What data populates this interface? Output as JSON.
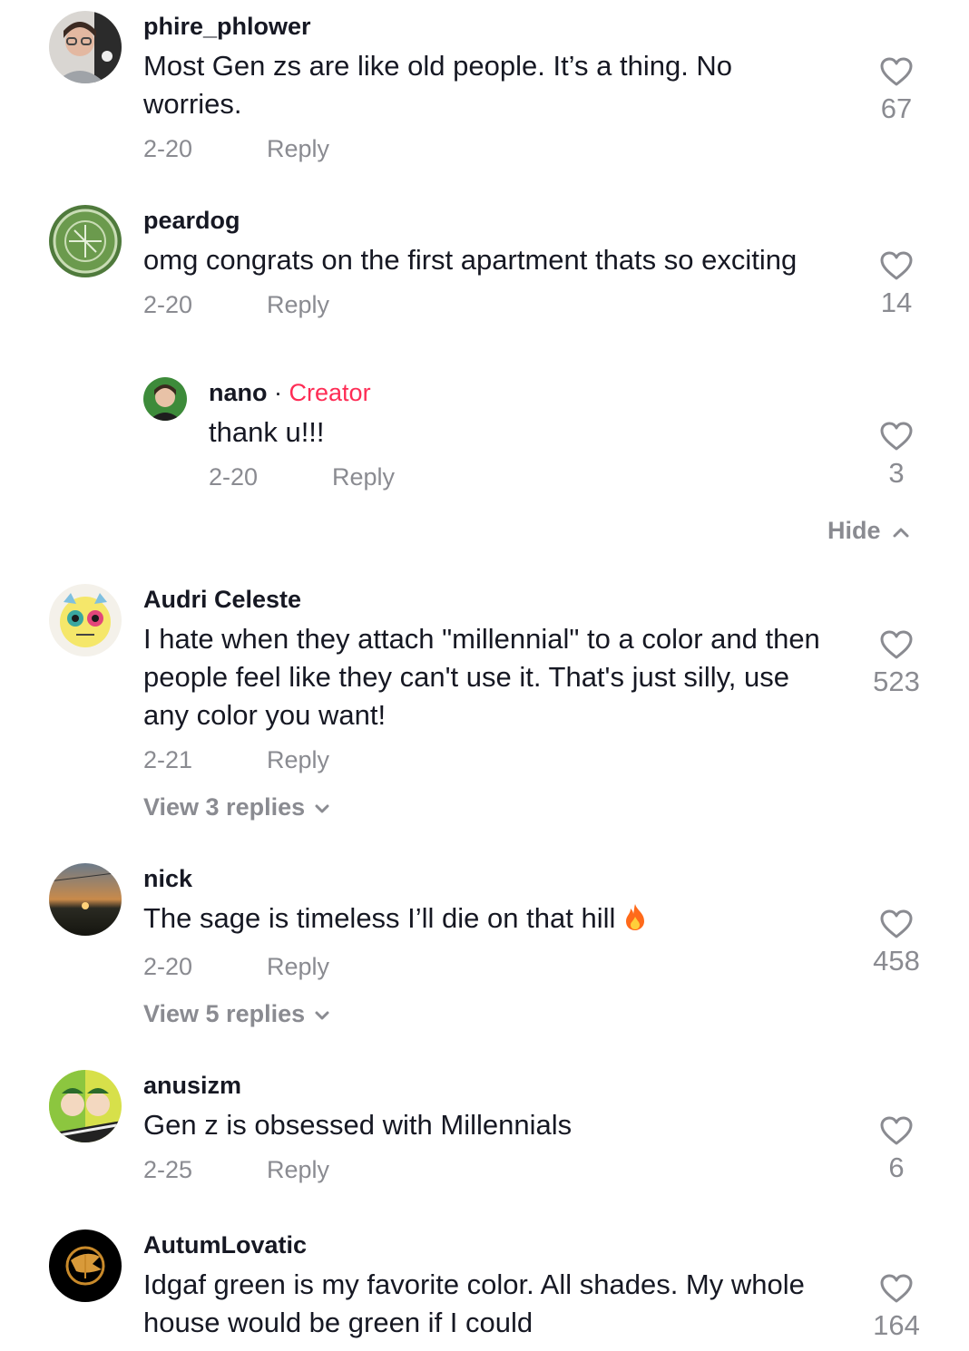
{
  "comments": [
    {
      "username": "phire_phlower",
      "text": "Most Gen zs are like old people. It’s a thing. No worries.",
      "date": "2-20",
      "reply_label": "Reply",
      "likes": "67"
    },
    {
      "username": "peardog",
      "text": "omg congrats on the first apartment thats so exciting",
      "date": "2-20",
      "reply_label": "Reply",
      "likes": "14"
    },
    {
      "username": "Audri Celeste",
      "text": "I hate when they attach \"millennial\" to a color and then people feel like they can't use it. That's just silly, use any color you want!",
      "date": "2-21",
      "reply_label": "Reply",
      "likes": "523",
      "view_replies": "View 3 replies"
    },
    {
      "username": "nick",
      "text": "The sage is timeless I’ll die on that hill",
      "emoji": "fire-emoji",
      "date": "2-20",
      "reply_label": "Reply",
      "likes": "458",
      "view_replies": "View 5 replies"
    },
    {
      "username": "anusizm",
      "text": "Gen z is obsessed with Millennials",
      "date": "2-25",
      "reply_label": "Reply",
      "likes": "6"
    },
    {
      "username": "AutumLovatic",
      "text": "Idgaf green is my favorite color. All shades. My whole house would be green if I could",
      "likes": "164"
    }
  ],
  "creator_reply": {
    "username": "nano",
    "separator": "·",
    "badge": "Creator",
    "text": "thank u!!!",
    "date": "2-20",
    "reply_label": "Reply",
    "likes": "3"
  },
  "hide_label": "Hide",
  "colors": {
    "accent_creator": "#fe2c55",
    "muted": "#8a8b91",
    "text": "#161823"
  }
}
